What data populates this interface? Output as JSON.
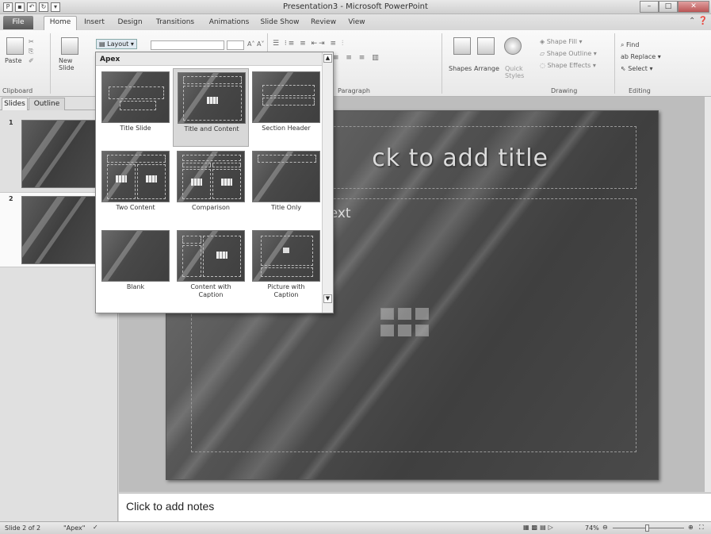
{
  "window": {
    "title": "Presentation3 - Microsoft PowerPoint"
  },
  "tabs": [
    "File",
    "Home",
    "Insert",
    "Design",
    "Transitions",
    "Animations",
    "Slide Show",
    "Review",
    "View"
  ],
  "ribbon": {
    "paste": "Paste",
    "new_slide": "New\nSlide",
    "layout": "Layout",
    "clipboard": "Clipboard",
    "paragraph": "Paragraph",
    "shapes": "Shapes",
    "arrange": "Arrange",
    "quick_styles": "Quick\nStyles",
    "shape_fill": "Shape Fill",
    "shape_outline": "Shape Outline",
    "shape_effects": "Shape Effects",
    "drawing": "Drawing",
    "find": "Find",
    "replace": "Replace",
    "select": "Select",
    "editing": "Editing"
  },
  "pane_tabs": {
    "slides": "Slides",
    "outline": "Outline"
  },
  "thumbnails": [
    "1",
    "2"
  ],
  "slide": {
    "title": "ck to add title",
    "body": "text"
  },
  "notes": "Click to add notes",
  "status": {
    "slide": "Slide 2 of 2",
    "theme": "\"Apex\"",
    "zoom": "74%"
  },
  "gallery": {
    "header": "Apex",
    "items": [
      "Title Slide",
      "Title and Content",
      "Section Header",
      "Two Content",
      "Comparison",
      "Title Only",
      "Blank",
      "Content with\nCaption",
      "Picture with\nCaption"
    ]
  }
}
